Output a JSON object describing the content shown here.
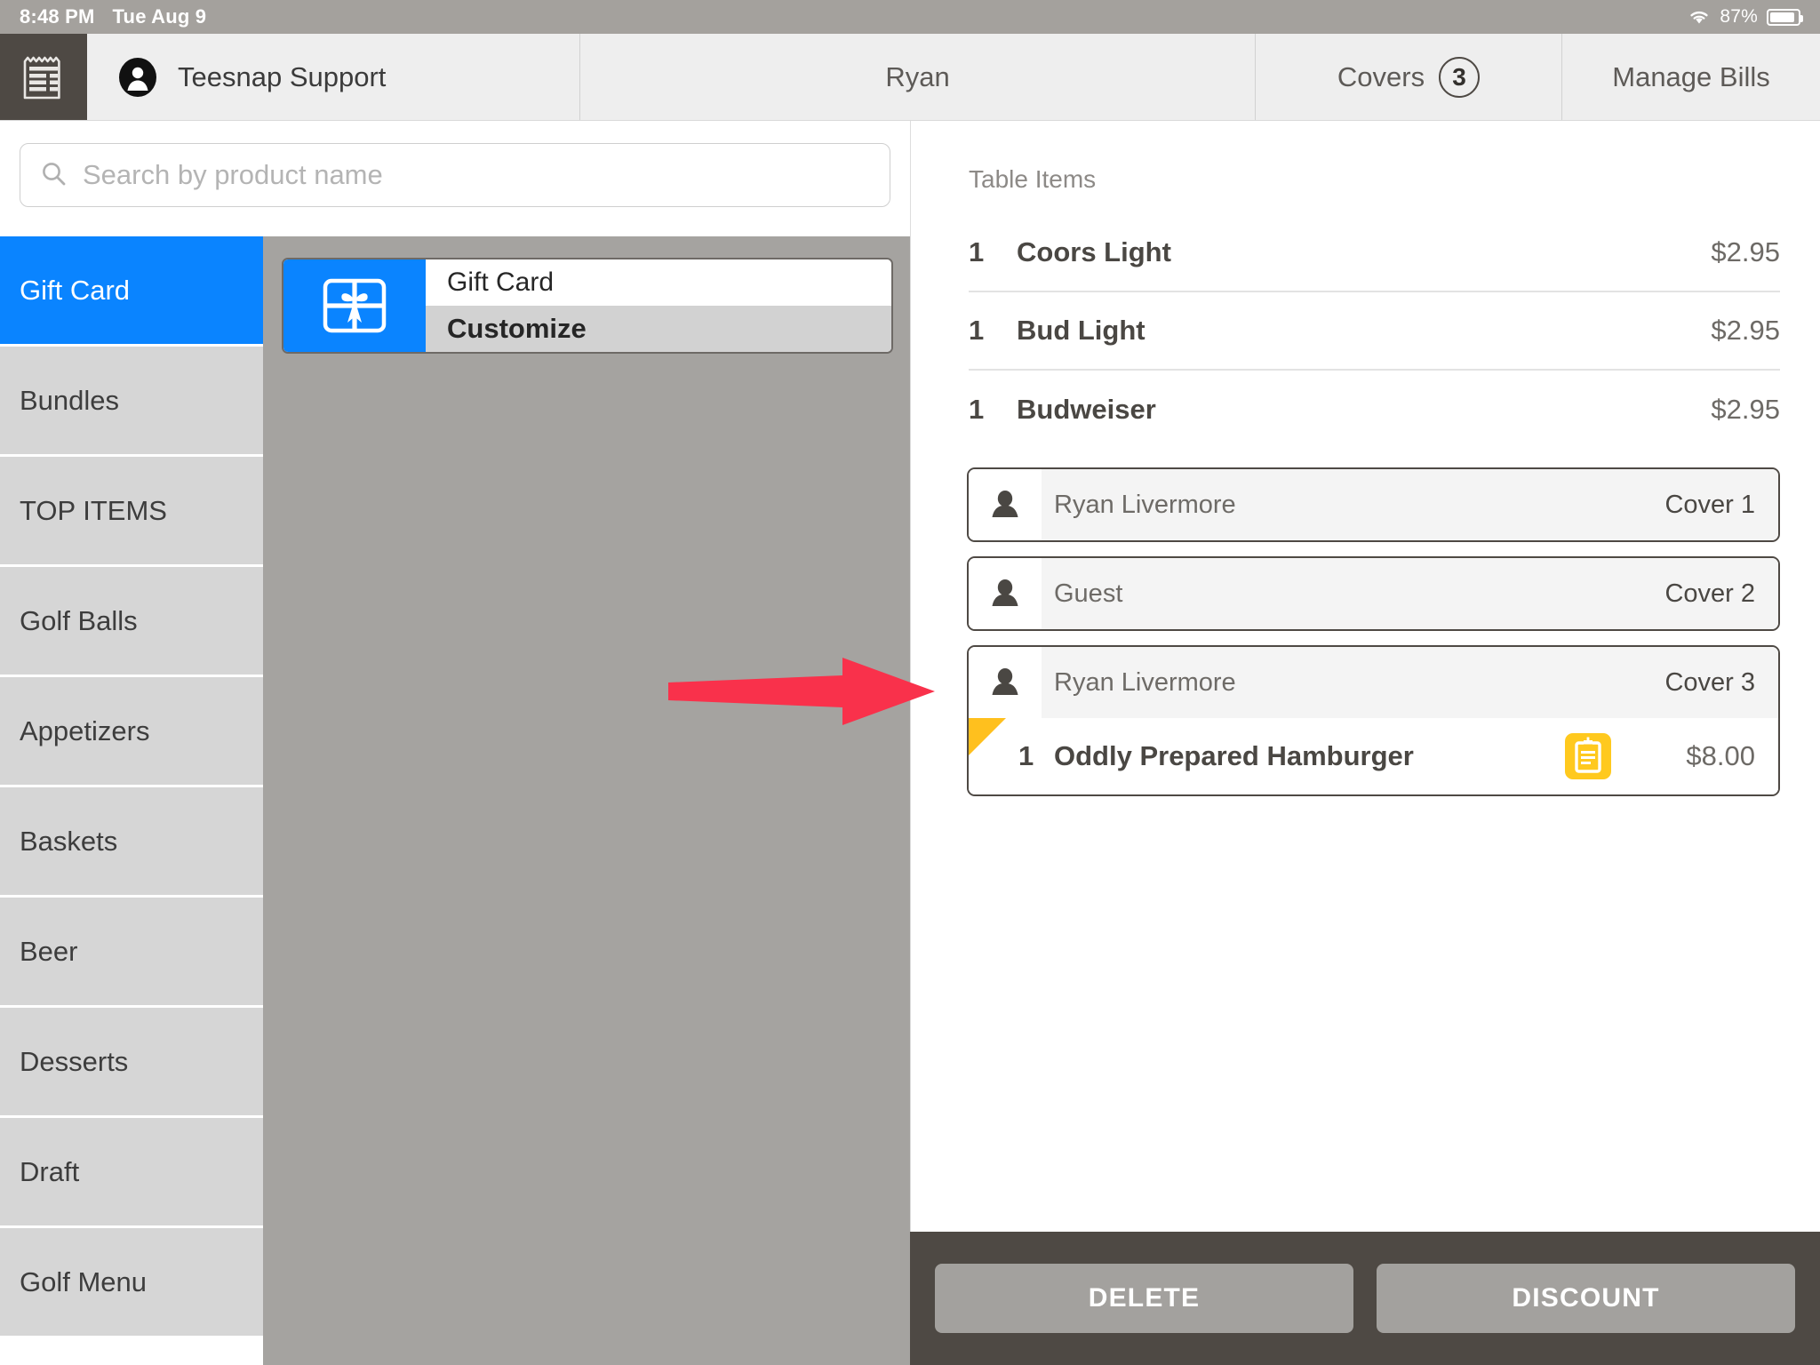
{
  "statusbar": {
    "time": "8:48 PM",
    "date": "Tue Aug 9",
    "battery_percent": "87%",
    "wifi_icon": "wifi-icon",
    "battery_icon": "battery-icon"
  },
  "topnav": {
    "receipt_icon": "receipt-icon",
    "avatar_icon": "avatar-icon",
    "user_label": "Teesnap Support",
    "table_label": "Ryan",
    "covers_label": "Covers",
    "covers_count": "3",
    "manage_bills_label": "Manage Bills"
  },
  "search": {
    "placeholder": "Search by product name",
    "value": "",
    "icon": "search-icon"
  },
  "categories": [
    {
      "label": "Gift Card",
      "active": true
    },
    {
      "label": "Bundles",
      "active": false
    },
    {
      "label": "TOP ITEMS",
      "active": false
    },
    {
      "label": "Golf Balls",
      "active": false
    },
    {
      "label": "Appetizers",
      "active": false
    },
    {
      "label": "Baskets",
      "active": false
    },
    {
      "label": "Beer",
      "active": false
    },
    {
      "label": "Desserts",
      "active": false
    },
    {
      "label": "Draft",
      "active": false
    },
    {
      "label": "Golf Menu",
      "active": false
    }
  ],
  "products": [
    {
      "title": "Gift Card",
      "subtitle": "Customize",
      "icon": "gift-card-icon",
      "accent": "#0a84ff"
    }
  ],
  "table_panel": {
    "heading": "Table Items",
    "items": [
      {
        "qty": "1",
        "name": "Coors Light",
        "price": "$2.95"
      },
      {
        "qty": "1",
        "name": "Bud Light",
        "price": "$2.95"
      },
      {
        "qty": "1",
        "name": "Budweiser",
        "price": "$2.95"
      }
    ],
    "covers": [
      {
        "name": "Ryan Livermore",
        "cover_label": "Cover 1",
        "person_icon": "person-icon",
        "items": []
      },
      {
        "name": "Guest",
        "cover_label": "Cover 2",
        "person_icon": "person-icon",
        "items": []
      },
      {
        "name": "Ryan Livermore",
        "cover_label": "Cover 3",
        "person_icon": "person-icon",
        "items": [
          {
            "qty": "1",
            "name": "Oddly Prepared Hamburger",
            "price": "$8.00",
            "note_icon": "note-clipboard-icon",
            "note_color": "#ffc91e",
            "flag_color": "#ffc01e"
          }
        ]
      }
    ]
  },
  "footer": {
    "delete_label": "DELETE",
    "discount_label": "DISCOUNT"
  },
  "annotation": {
    "arrow_icon": "right-arrow-annotation",
    "arrow_color": "#f9314b"
  },
  "colors": {
    "accent_blue": "#0a84ff",
    "dark_chrome": "#4e4944",
    "grid_gray": "#a5a3a0",
    "category_gray": "#d6d6d6",
    "note_yellow": "#ffc91e"
  }
}
